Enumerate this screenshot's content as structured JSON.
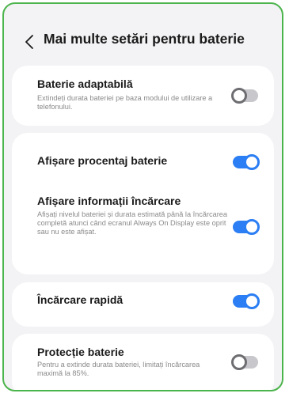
{
  "header": {
    "title": "Mai multe setări pentru baterie",
    "back_icon": "chevron-left-icon"
  },
  "settings": [
    {
      "title": "Baterie adaptabilă",
      "description": "Extindeți durata bateriei pe baza modului de utilizare a telefonului.",
      "enabled": false
    },
    {
      "title": "Afișare procentaj baterie",
      "description": "",
      "enabled": true
    },
    {
      "title": "Afișare informații încărcare",
      "description": "Afișați nivelul bateriei și durata estimată până la încărcarea completă atunci când ecranul Always On Display este oprit sau nu este afișat.",
      "enabled": true
    },
    {
      "title": "Încărcare rapidă",
      "description": "",
      "enabled": true
    },
    {
      "title": "Protecție baterie",
      "description": "Pentru a extinde durata bateriei, limitați încărcarea maximă la 85%.",
      "enabled": false
    }
  ],
  "colors": {
    "accent": "#2b7ef3",
    "frame_border": "#4cb44c",
    "background": "#f3f3f5",
    "toggle_off_track": "#c8c8cc",
    "toggle_off_knob": "#6e6e72"
  }
}
